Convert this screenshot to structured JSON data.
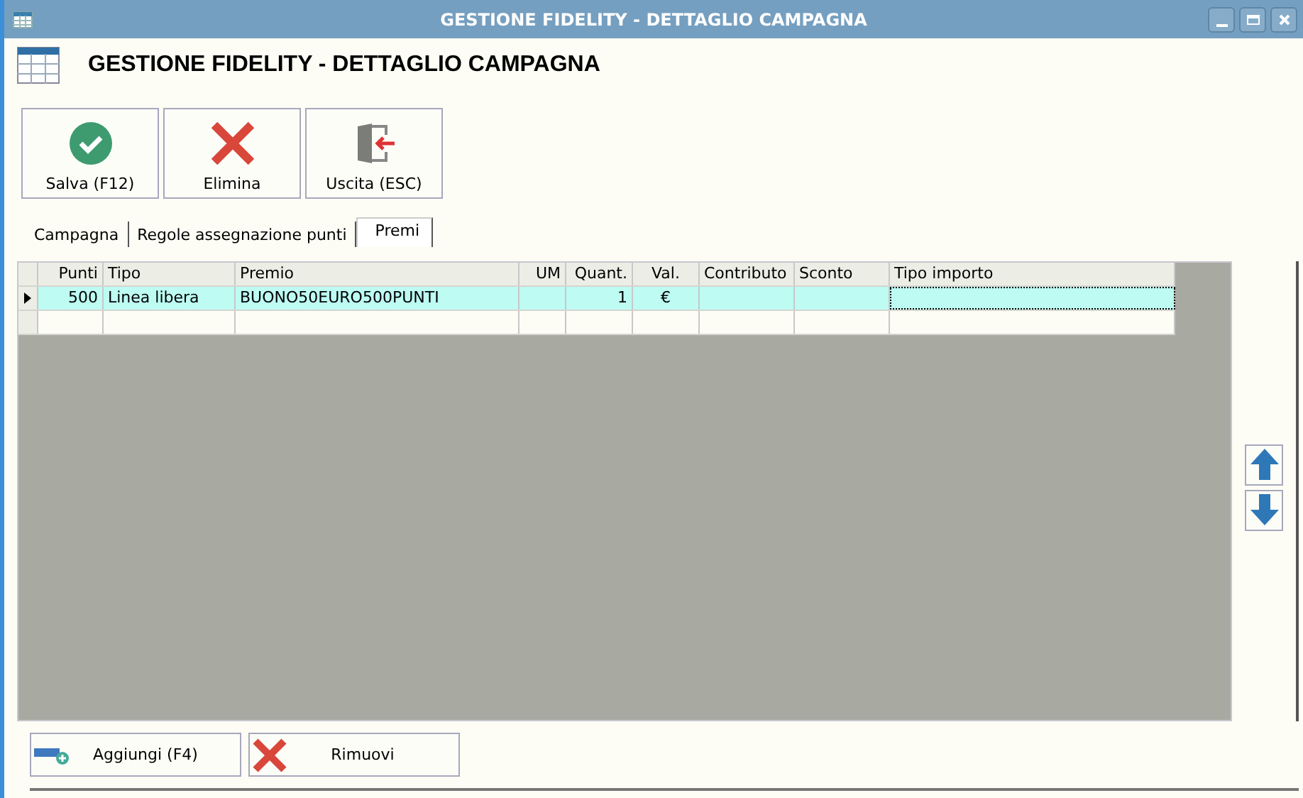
{
  "window": {
    "title": "GESTIONE FIDELITY - DETTAGLIO CAMPAGNA"
  },
  "header": {
    "title": "GESTIONE FIDELITY - DETTAGLIO CAMPAGNA"
  },
  "toolbar": [
    {
      "kind": "save",
      "label": "Salva (F12)"
    },
    {
      "kind": "delete",
      "label": "Elimina"
    },
    {
      "kind": "exit",
      "label": "Uscita (ESC)"
    }
  ],
  "tabs": [
    {
      "label": "Campagna",
      "selected": false
    },
    {
      "label": "Regole assegnazione punti",
      "selected": false
    },
    {
      "label": "Premi",
      "selected": true
    }
  ],
  "table": {
    "columns": [
      {
        "label": "Punti"
      },
      {
        "label": "Tipo"
      },
      {
        "label": "Premio"
      },
      {
        "label": "UM"
      },
      {
        "label": "Quant."
      },
      {
        "label": "Val."
      },
      {
        "label": "Contributo"
      },
      {
        "label": "Sconto"
      },
      {
        "label": "Tipo importo"
      }
    ],
    "rows": [
      {
        "selected": true,
        "cells": [
          "500",
          "Linea libera",
          "BUONO50EURO500PUNTI",
          null,
          "1",
          "€",
          null,
          null,
          null
        ]
      }
    ]
  },
  "bottom_buttons": [
    {
      "kind": "add",
      "label": "Aggiungi (F4)"
    },
    {
      "kind": "remove",
      "label": "Rimuovi"
    }
  ]
}
